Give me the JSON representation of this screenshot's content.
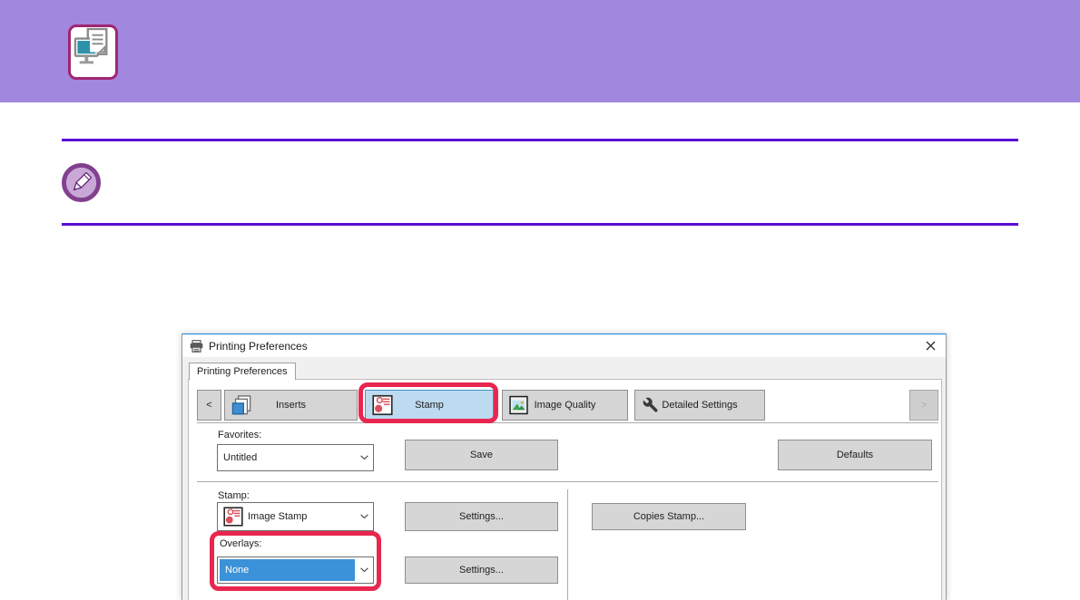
{
  "dialog": {
    "title": "Printing Preferences",
    "tab_label": "Printing Preferences",
    "toolbar": {
      "prev_label": "<",
      "next_label": ">",
      "tabs": [
        {
          "label": "Inserts",
          "icon": "inserts-icon"
        },
        {
          "label": "Stamp",
          "icon": "stamp-icon",
          "selected": true,
          "highlighted": true
        },
        {
          "label": "Image Quality",
          "icon": "image-quality-icon"
        },
        {
          "label": "Detailed Settings",
          "icon": "wrench-icon"
        }
      ]
    },
    "favorites": {
      "label": "Favorites:",
      "selected_value": "Untitled",
      "save_label": "Save",
      "defaults_label": "Defaults"
    },
    "stamp": {
      "label": "Stamp:",
      "selected_value": "Image Stamp",
      "settings_label": "Settings...",
      "copies_label": "Copies Stamp..."
    },
    "overlays": {
      "label": "Overlays:",
      "selected_value": "None",
      "settings_label": "Settings...",
      "highlighted": true
    }
  },
  "colors": {
    "banner_purple": "#a287de",
    "divider_purple": "#5a0ed6",
    "callout_red": "#e8274f",
    "selected_tab_blue": "#bddbf0",
    "combo_selection_blue": "#3c92d8",
    "icon_box_border": "#a12572",
    "note_ring_purple": "#82408f",
    "monitor_teal": "#2d92a8"
  }
}
